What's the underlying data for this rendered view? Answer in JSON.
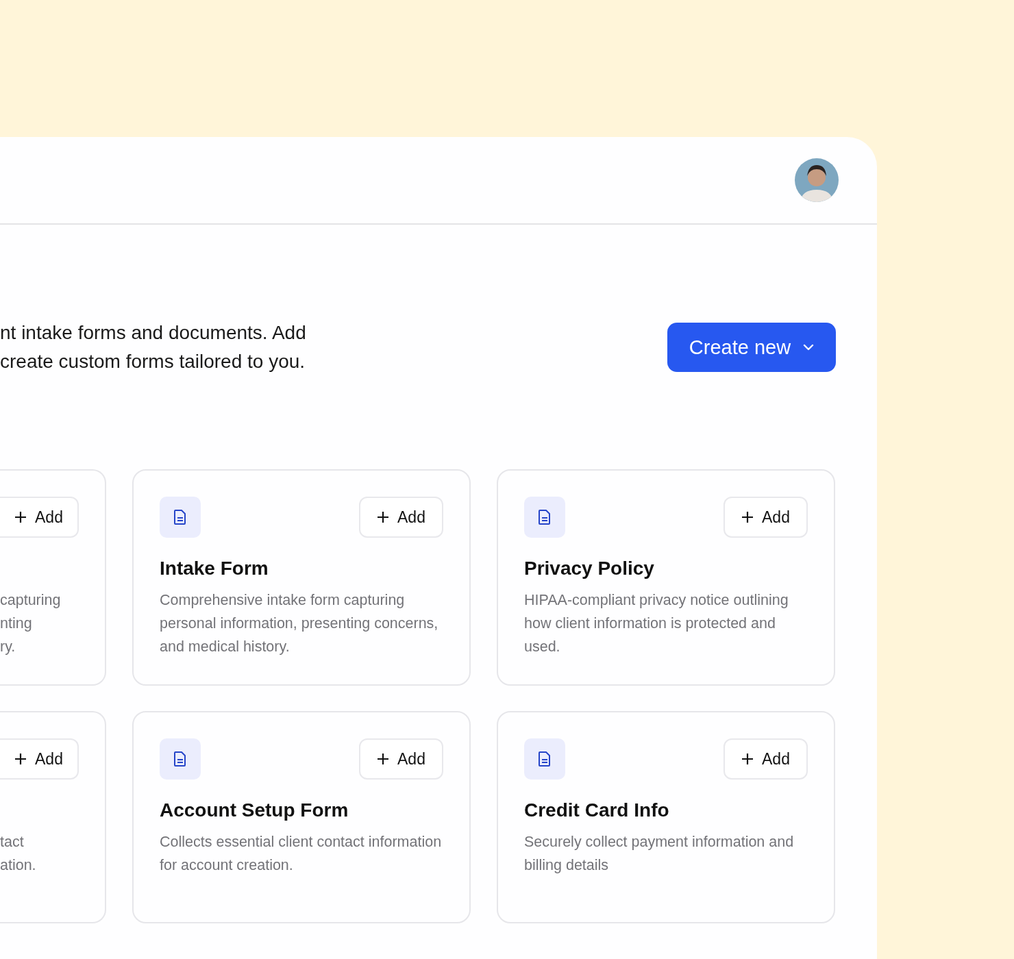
{
  "intro": {
    "lines": [
      "nt intake forms and documents. Add",
      "create custom forms tailored to you."
    ]
  },
  "create_button": {
    "label": "Create new"
  },
  "templates": [
    {
      "kind": "partial",
      "button": "Add",
      "description_lines": [
        "capturing",
        "nting",
        "ry."
      ]
    },
    {
      "kind": "full",
      "title": "Intake Form",
      "description": "Comprehensive intake form capturing personal information, presenting concerns, and medical history.",
      "button": "Add"
    },
    {
      "kind": "full",
      "title": "Privacy Policy",
      "description": "HIPAA-compliant privacy notice outlining how client information is protected and used.",
      "button": "Add"
    },
    {
      "kind": "partial",
      "button": "Add",
      "description_lines": [
        "tact",
        "ation."
      ]
    },
    {
      "kind": "full",
      "title": "Account Setup Form",
      "description": "Collects essential client contact information for account creation.",
      "button": "Add"
    },
    {
      "kind": "full",
      "title": "Credit Card Info",
      "description": "Securely collect payment information and billing details",
      "button": "Add"
    }
  ]
}
